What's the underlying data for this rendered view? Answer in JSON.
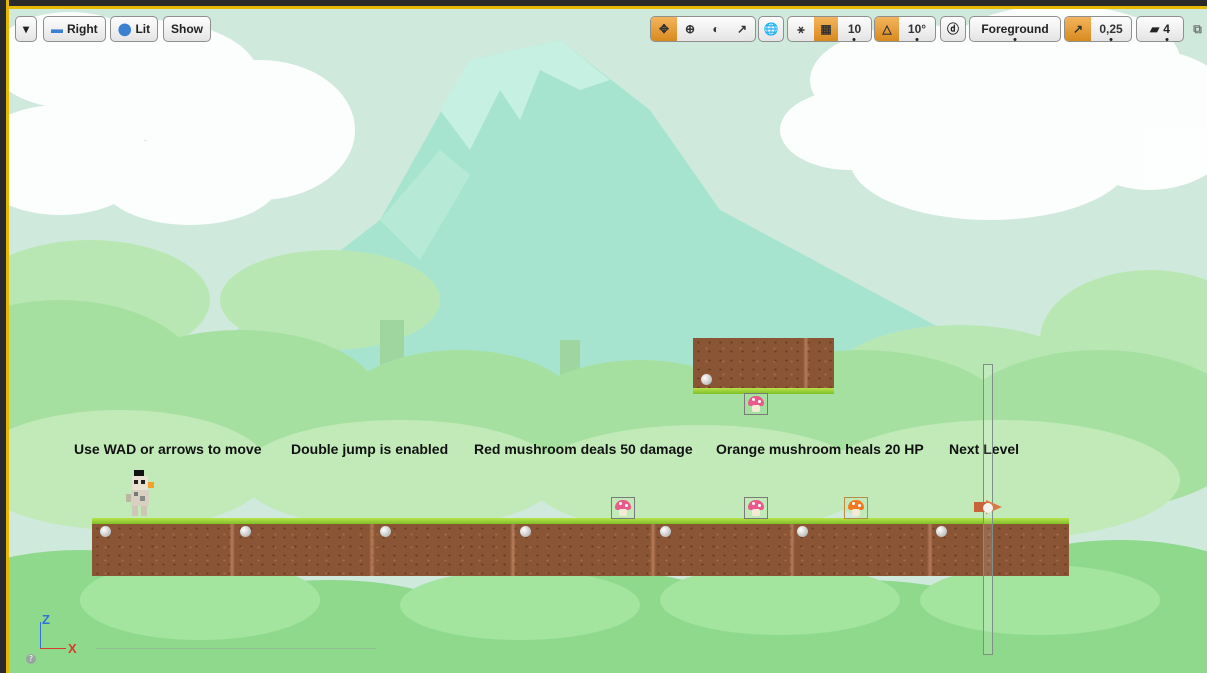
{
  "toolbar": {
    "left": {
      "dropdown_label": "",
      "view_mode": "Right",
      "lighting": "Lit",
      "show": "Show"
    },
    "right": {
      "grid_snap_value": "10",
      "rotation_snap_value": "10°",
      "layer": "Foreground",
      "scale_snap_value": "0,25",
      "camera_speed": "4"
    }
  },
  "level": {
    "hints": [
      "Use WAD or arrows to move",
      "Double jump is enabled",
      "Red mushroom deals 50 damage",
      "Orange mushroom heals 20 HP",
      "Next Level"
    ]
  },
  "axis": {
    "z_label": "Z",
    "x_label": "X"
  },
  "colors": {
    "sky": "#cfe9dd",
    "mountain": "#a7e4cf",
    "foliage_light": "#b2e6a9",
    "foliage_dark": "#8cd48a",
    "dirt": "#8a5535",
    "grass": "#98d138",
    "active_button": "#e09a33",
    "selection_border": "#e6b800"
  },
  "icons": [
    "chevron-down-icon",
    "right-view-icon",
    "lit-sphere-icon",
    "translate-icon",
    "rotate-icon",
    "scale-icon",
    "transform-icon",
    "world-local-icon",
    "surface-snap-icon",
    "grid-snap-icon",
    "angle-snap-icon",
    "layer-icon",
    "scale-snap-icon",
    "camera-speed-icon",
    "maximize-icon"
  ]
}
